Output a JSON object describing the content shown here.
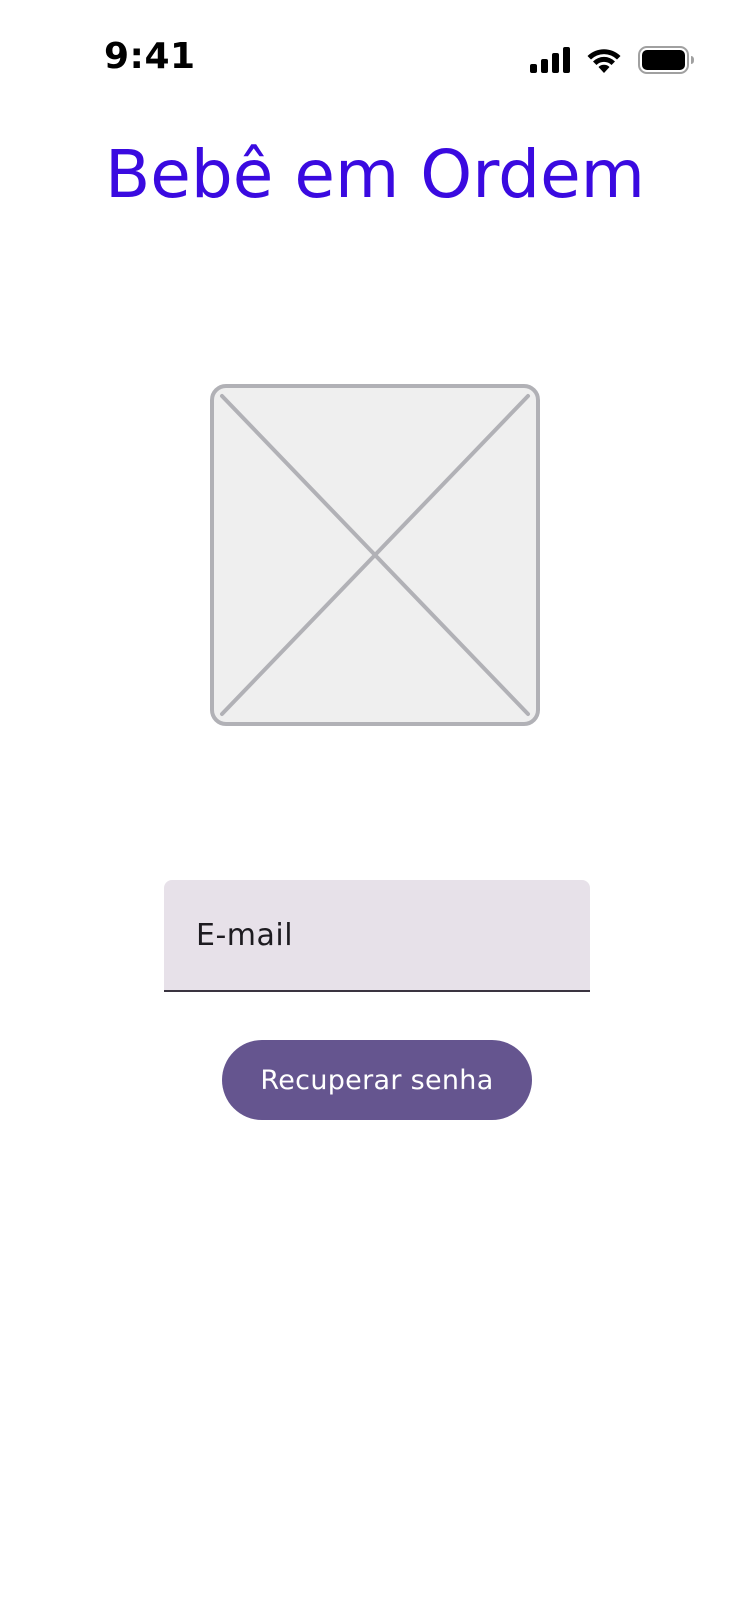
{
  "status_bar": {
    "time": "9:41",
    "icons": [
      "cellular-signal-icon",
      "wifi-icon",
      "battery-icon"
    ]
  },
  "header": {
    "title": "Bebê em Ordem"
  },
  "image": {
    "icon": "image-placeholder-icon"
  },
  "form": {
    "email_placeholder": "E-mail",
    "email_value": "",
    "submit_label": "Recuperar senha"
  },
  "colors": {
    "title": "#3a0ae0",
    "field_background": "#e7e1e9",
    "field_underline": "#3a3440",
    "button_background": "#65558f",
    "button_text": "#ffffff",
    "placeholder_fill": "#efefef",
    "placeholder_stroke": "#b1b1b6"
  }
}
